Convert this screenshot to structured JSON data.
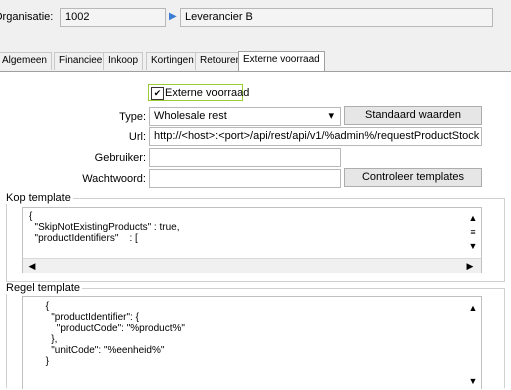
{
  "header": {
    "org_label": "Organisatie:",
    "org_value": "1002",
    "supplier_value": "Leverancier B"
  },
  "tabs": [
    {
      "label": "Algemeen"
    },
    {
      "label": "Financieel"
    },
    {
      "label": "Inkoop"
    },
    {
      "label": "Kortingen"
    },
    {
      "label": "Retouren"
    },
    {
      "label": "Externe voorraad"
    }
  ],
  "form": {
    "checkbox_label": "Externe voorraad",
    "checkbox_checked": "✔",
    "type_label": "Type:",
    "type_value": "Wholesale rest",
    "url_label": "Url:",
    "url_value": "http://<host>:<port>/api/rest/api/v1/%admin%/requestProductStock",
    "user_label": "Gebruiker:",
    "user_value": "",
    "password_label": "Wachtwoord:",
    "password_value": "",
    "default_button": "Standaard waarden",
    "check_button": "Controleer templates"
  },
  "kop_template": {
    "title": "Kop template",
    "text": "{\n  \"SkipNotExistingProducts\" : true,\n  \"productIdentifiers\"    : ["
  },
  "regel_template": {
    "title": "Regel template",
    "text": "      {\n        \"productIdentifier\": {\n          \"productCode\": \"%product%\"\n        },\n        \"unitCode\": \"%eenheid%\"\n      }"
  },
  "icons": {
    "supplier_arrow": "▶",
    "dropdown": "▾",
    "scroll_up": "▲",
    "scroll_down": "▼",
    "scroll_left": "◀",
    "scroll_right": "▶",
    "scroll_grip": "≡"
  }
}
